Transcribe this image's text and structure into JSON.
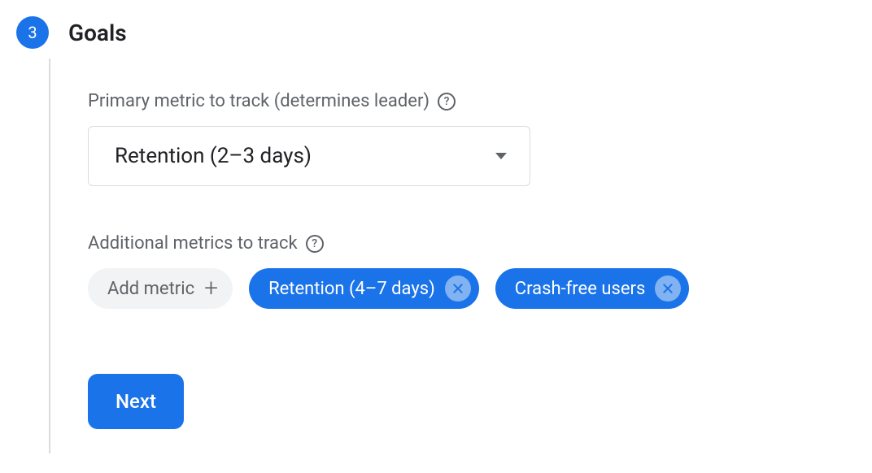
{
  "step": {
    "number": "3",
    "title": "Goals"
  },
  "primary_metric": {
    "label": "Primary metric to track (determines leader)",
    "selected": "Retention (2–3 days)"
  },
  "additional_metrics": {
    "label": "Additional metrics to track",
    "add_label": "Add metric",
    "chips": [
      {
        "label": "Retention (4–7 days)"
      },
      {
        "label": "Crash-free users"
      }
    ]
  },
  "actions": {
    "next": "Next"
  }
}
